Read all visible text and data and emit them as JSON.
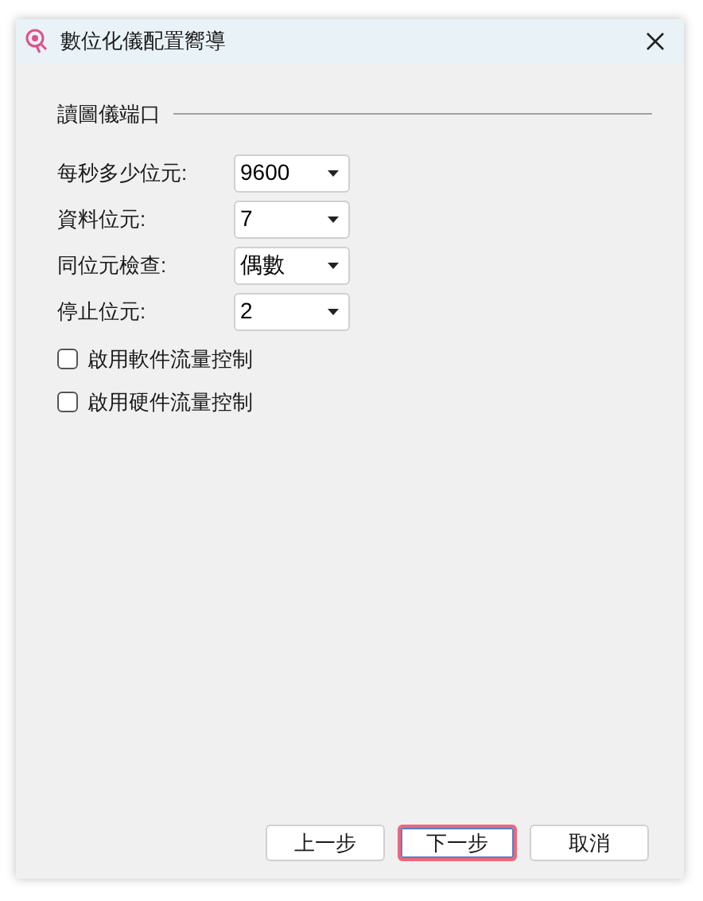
{
  "window": {
    "title": "數位化儀配置嚮導"
  },
  "group": {
    "title": "讀圖儀端口"
  },
  "fields": [
    {
      "label": "每秒多少位元:",
      "value": "9600"
    },
    {
      "label": "資料位元:",
      "value": "7"
    },
    {
      "label": "同位元檢查:",
      "value": "偶數"
    },
    {
      "label": "停止位元:",
      "value": "2"
    }
  ],
  "checkboxes": [
    {
      "label": "啟用軟件流量控制",
      "checked": false
    },
    {
      "label": "啟用硬件流量控制",
      "checked": false
    }
  ],
  "buttons": [
    {
      "label": "上一步",
      "focused": false
    },
    {
      "label": "下一步",
      "focused": true
    },
    {
      "label": "取消",
      "focused": false
    }
  ]
}
